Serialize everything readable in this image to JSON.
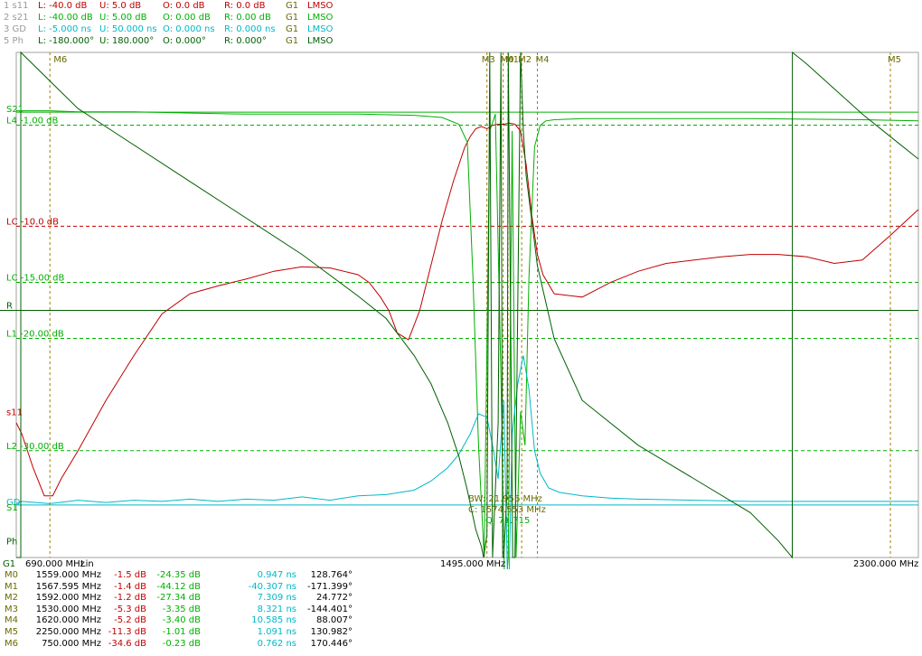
{
  "header": [
    {
      "id": "1 s11",
      "L": "L: -40.0 dB",
      "U": "U: 5.0 dB",
      "O": "O: 0.0 dB",
      "R": "R: 0.0 dB",
      "G": "G1",
      "M": "LMSO",
      "color": "#c00000",
      "active": true
    },
    {
      "id": "2 s21",
      "L": "L: -40.00 dB",
      "U": "U: 5.00 dB",
      "O": "O: 0.00 dB",
      "R": "R: 0.00 dB",
      "G": "G1",
      "M": "LMSO",
      "color": "#00b000",
      "active": true
    },
    {
      "id": "3 GD",
      "L": "L: -5.000 ns",
      "U": "U: 50.000 ns",
      "O": "O: 0.000 ns",
      "R": "R: 0.000 ns",
      "G": "G1",
      "M": "LMSO",
      "color": "#00b8c8",
      "active": true
    },
    {
      "id": "5 Ph",
      "L": "L: -180.000°",
      "U": "U: 180.000°",
      "O": "O: 0.000°",
      "R": "R: 0.000°",
      "G": "G1",
      "M": "LMSO",
      "color": "#006000",
      "active": true
    }
  ],
  "chart_data": {
    "type": "line",
    "x_axis": {
      "start": "690.000 MHz",
      "center": "1495.000 MHz",
      "stop": "2300.000 MHz",
      "scale": "Lin",
      "group": "G1",
      "xlim": [
        690,
        2300
      ]
    },
    "ref_labels": [
      {
        "text": "S21",
        "color": "#00b000",
        "value": 0
      },
      {
        "text": "L4 -1.00 dB",
        "color": "#00b000",
        "value": -1
      },
      {
        "text": "LC -10.0 dB",
        "color": "#c00000",
        "value": -10
      },
      {
        "text": "LC -15.00 dB",
        "color": "#00b000",
        "value": -15
      },
      {
        "text": "R",
        "color": "#006000",
        "value": -17.5
      },
      {
        "text": "L1 -20.00 dB",
        "color": "#00b000",
        "value": -20
      },
      {
        "text": "s11",
        "color": "#c00000",
        "value": -27
      },
      {
        "text": "L2 -30.00 dB",
        "color": "#00b000",
        "value": -30
      },
      {
        "text": "GD",
        "color": "#00b8c8",
        "value": -35
      },
      {
        "text": "S1",
        "color": "#00b000",
        "value": -35.5
      },
      {
        "text": "Ph",
        "color": "#006000",
        "value": -38.5
      }
    ],
    "ylim_db": [
      -40,
      5
    ],
    "markers": [
      {
        "name": "M0",
        "freq_mhz": 1559.0,
        "freq": "1559.000 MHz",
        "s11": "-1.5 dB",
        "s21": "-24.35 dB",
        "gd": "0.947 ns",
        "ph": "128.764°"
      },
      {
        "name": "M1",
        "freq_mhz": 1567.595,
        "freq": "1567.595 MHz",
        "s11": "-1.4 dB",
        "s21": "-44.12 dB",
        "gd": "-40.307 ns",
        "ph": "-171.399°"
      },
      {
        "name": "M2",
        "freq_mhz": 1592.0,
        "freq": "1592.000 MHz",
        "s11": "-1.2 dB",
        "s21": "-27.34 dB",
        "gd": "7.309 ns",
        "ph": "24.772°"
      },
      {
        "name": "M3",
        "freq_mhz": 1530.0,
        "freq": "1530.000 MHz",
        "s11": "-5.3 dB",
        "s21": "-3.35 dB",
        "gd": "8.321 ns",
        "ph": "-144.401°"
      },
      {
        "name": "M4",
        "freq_mhz": 1620.0,
        "freq": "1620.000 MHz",
        "s11": "-5.2 dB",
        "s21": "-3.40 dB",
        "gd": "10.585 ns",
        "ph": "88.007°"
      },
      {
        "name": "M5",
        "freq_mhz": 2250.0,
        "freq": "2250.000 MHz",
        "s11": "-11.3 dB",
        "s21": "-1.01 dB",
        "gd": "1.091 ns",
        "ph": "130.982°"
      },
      {
        "name": "M6",
        "freq_mhz": 750.0,
        "freq": "750.000 MHz",
        "s11": "-34.6 dB",
        "s21": "-0.23 dB",
        "gd": "0.762 ns",
        "ph": "170.446°"
      }
    ],
    "marker_top_labels": [
      "M6",
      "M3",
      "M0",
      "M1",
      "M2",
      "M4",
      "M5"
    ],
    "bw_annotation": {
      "bw": "BW: 21.956 MHz",
      "c": "C: 1574.553 MHz",
      "q": "Q: 71.715"
    },
    "series": [
      {
        "name": "s11",
        "color": "#c00000",
        "x": [
          690,
          700,
          720,
          740,
          755,
          770,
          800,
          850,
          900,
          950,
          1000,
          1050,
          1100,
          1150,
          1200,
          1250,
          1300,
          1320,
          1340,
          1355,
          1370,
          1390,
          1410,
          1430,
          1450,
          1470,
          1490,
          1500,
          1510,
          1520,
          1530,
          1540,
          1550,
          1560,
          1570,
          1580,
          1590,
          1600,
          1610,
          1620,
          1630,
          1650,
          1700,
          1750,
          1800,
          1850,
          1900,
          1950,
          2000,
          2050,
          2100,
          2150,
          2200,
          2250,
          2300
        ],
        "y": [
          -28,
          -29,
          -32,
          -34.5,
          -34.5,
          -33,
          -30.5,
          -26,
          -22,
          -18.3,
          -16.5,
          -15.8,
          -15.2,
          -14.5,
          -14.1,
          -14.2,
          -14.8,
          -15.5,
          -16.8,
          -18,
          -20,
          -20.6,
          -18,
          -14,
          -10,
          -6.5,
          -3.5,
          -2.5,
          -1.8,
          -1.6,
          -1.8,
          -1.5,
          -1.4,
          -1.4,
          -1.3,
          -1.4,
          -2,
          -5,
          -9.5,
          -13,
          -14.8,
          -16.5,
          -16.8,
          -15.5,
          -14.5,
          -13.8,
          -13.5,
          -13.2,
          -13,
          -13,
          -13.2,
          -13.8,
          -13.5,
          -11.3,
          -9
        ]
      },
      {
        "name": "s21",
        "color": "#00b000",
        "x": [
          690,
          750,
          800,
          900,
          1000,
          1100,
          1200,
          1300,
          1400,
          1450,
          1480,
          1495,
          1505,
          1515,
          1525,
          1535,
          1545,
          1555,
          1562,
          1568,
          1575,
          1582,
          1590,
          1598,
          1605,
          1615,
          1625,
          1635,
          1650,
          1700,
          1800,
          1900,
          2000,
          2100,
          2200,
          2300
        ],
        "y": [
          -0.2,
          -0.2,
          -0.3,
          -0.3,
          -0.4,
          -0.5,
          -0.5,
          -0.5,
          -0.6,
          -0.8,
          -1.4,
          -3,
          -15,
          -30,
          -40,
          -2,
          -0.5,
          -24,
          -44,
          -40,
          -2,
          -40,
          -27,
          -30,
          -15,
          -3.4,
          -1.5,
          -1.1,
          -1,
          -0.9,
          -0.9,
          -0.9,
          -0.9,
          -0.95,
          -1,
          -1.1
        ]
      },
      {
        "name": "GD",
        "color": "#00b8c8",
        "x": [
          690,
          700,
          750,
          800,
          850,
          900,
          950,
          1000,
          1050,
          1100,
          1150,
          1200,
          1250,
          1300,
          1350,
          1400,
          1430,
          1460,
          1480,
          1500,
          1515,
          1530,
          1540,
          1550,
          1560,
          1568,
          1575,
          1585,
          1595,
          1605,
          1615,
          1625,
          1640,
          1660,
          1700,
          1750,
          1800,
          1900,
          2000,
          2100,
          2200,
          2250,
          2300
        ],
        "y": [
          -35.2,
          -35,
          -35.2,
          -34.9,
          -35.1,
          -34.9,
          -35,
          -34.8,
          -35,
          -34.8,
          -34.9,
          -34.6,
          -34.9,
          -34.5,
          -34.4,
          -34,
          -33.2,
          -32,
          -30.8,
          -29,
          -27.2,
          -27.5,
          -30,
          -33,
          -26,
          -45,
          -29,
          -24.5,
          -22,
          -25,
          -30.5,
          -32.5,
          -33.8,
          -34.2,
          -34.5,
          -34.7,
          -34.8,
          -34.9,
          -35,
          -35,
          -35,
          -35,
          -35
        ]
      },
      {
        "name": "Ph",
        "color": "#006000",
        "x": [
          690,
          698,
          698.1,
          800,
          1000,
          1200,
          1300,
          1350,
          1400,
          1430,
          1460,
          1480,
          1495,
          1510,
          1520,
          1524,
          1530,
          1535,
          1540,
          1550,
          1555,
          1558,
          1560,
          1566,
          1568,
          1576,
          1580,
          1590,
          1595,
          1600,
          1620,
          1650,
          1700,
          1800,
          1900,
          2000,
          2050,
          2075,
          2075.1,
          2100,
          2200,
          2250,
          2300
        ],
        "y": [
          -40,
          -40,
          5,
          0,
          -6.5,
          -13,
          -16.7,
          -18.7,
          -22,
          -24.5,
          -28,
          -31,
          -34,
          -37.5,
          -39,
          -40,
          -38,
          5,
          -40,
          -28,
          5,
          -40,
          -40,
          -34,
          5,
          -40,
          -40,
          5,
          -2,
          -6,
          -14,
          -20.5,
          -26,
          -30,
          -33,
          -36,
          -38.5,
          -40,
          5,
          4,
          -0.5,
          -2.5,
          -4.5
        ]
      }
    ]
  }
}
